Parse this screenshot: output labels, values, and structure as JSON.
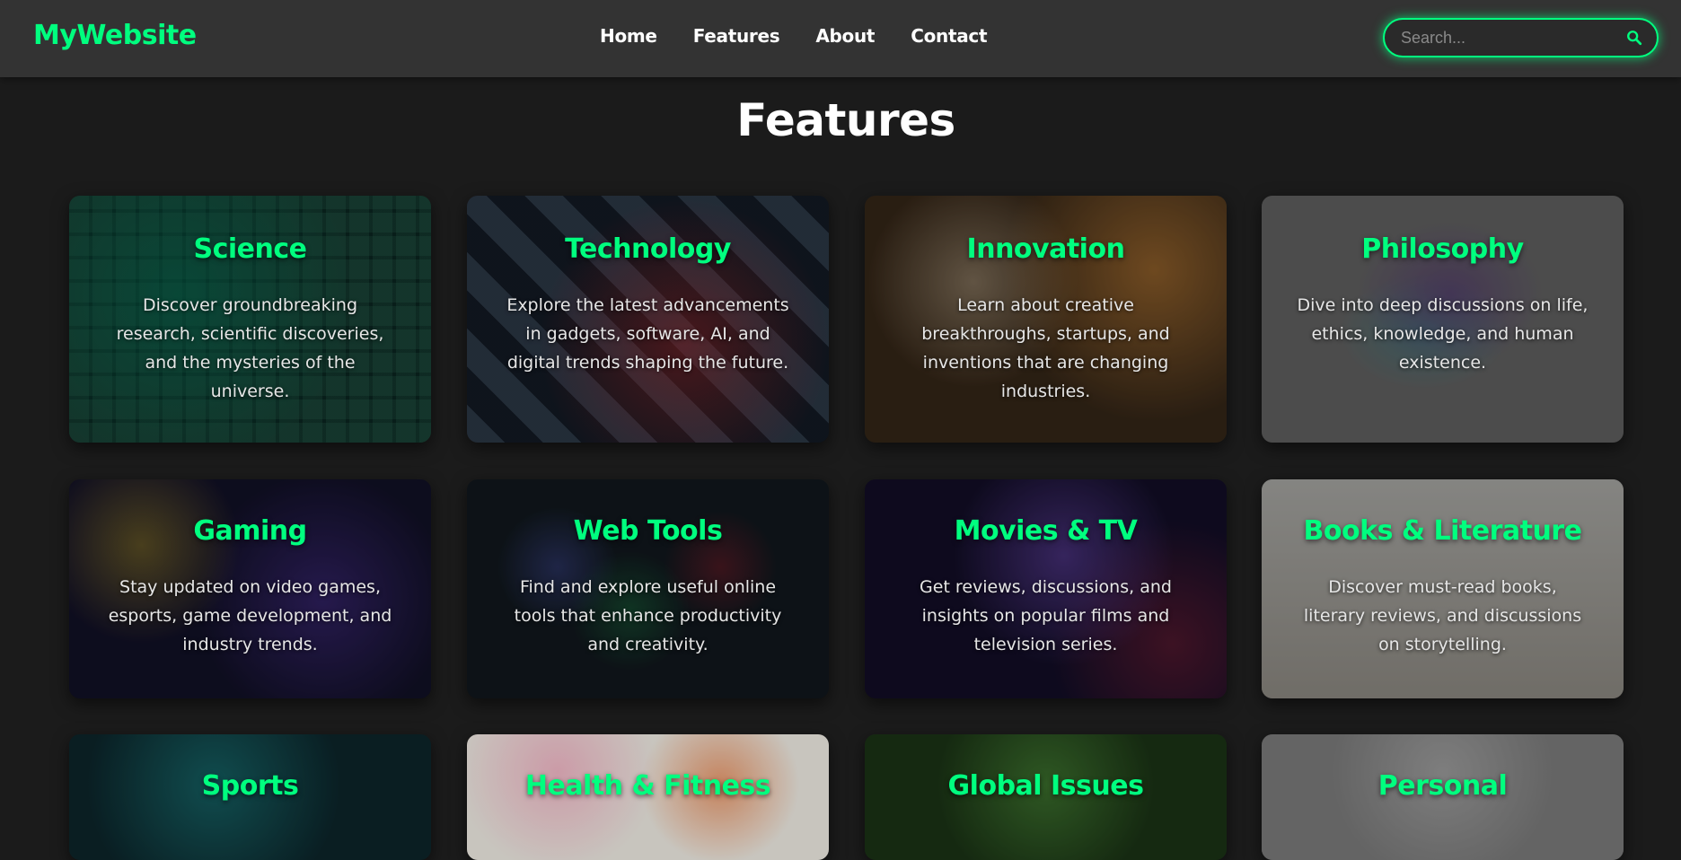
{
  "header": {
    "logo": "MyWebsite",
    "nav": [
      "Home",
      "Features",
      "About",
      "Contact"
    ],
    "search": {
      "placeholder": "Search...",
      "value": ""
    }
  },
  "main": {
    "title": "Features",
    "cards": [
      {
        "title": "Science",
        "desc": "Discover groundbreaking research, scientific discoveries, and the mysteries of the universe."
      },
      {
        "title": "Technology",
        "desc": "Explore the latest advancements in gadgets, software, AI, and digital trends shaping the future."
      },
      {
        "title": "Innovation",
        "desc": "Learn about creative breakthroughs, startups, and inventions that are changing industries."
      },
      {
        "title": "Philosophy",
        "desc": "Dive into deep discussions on life, ethics, knowledge, and human existence."
      },
      {
        "title": "Gaming",
        "desc": "Stay updated on video games, esports, game development, and industry trends."
      },
      {
        "title": "Web Tools",
        "desc": "Find and explore useful online tools that enhance productivity and creativity."
      },
      {
        "title": "Movies & TV",
        "desc": "Get reviews, discussions, and insights on popular films and television series."
      },
      {
        "title": "Books & Literature",
        "desc": "Discover must-read books, literary reviews, and discussions on storytelling."
      },
      {
        "title": "Sports",
        "desc": ""
      },
      {
        "title": "Health & Fitness",
        "desc": ""
      },
      {
        "title": "Global Issues",
        "desc": ""
      },
      {
        "title": "Personal",
        "desc": ""
      }
    ]
  },
  "colors": {
    "accent": "#00ff7f",
    "background": "#1b1b1b",
    "navbar": "#333333"
  },
  "icons": {
    "search": "search-icon"
  }
}
